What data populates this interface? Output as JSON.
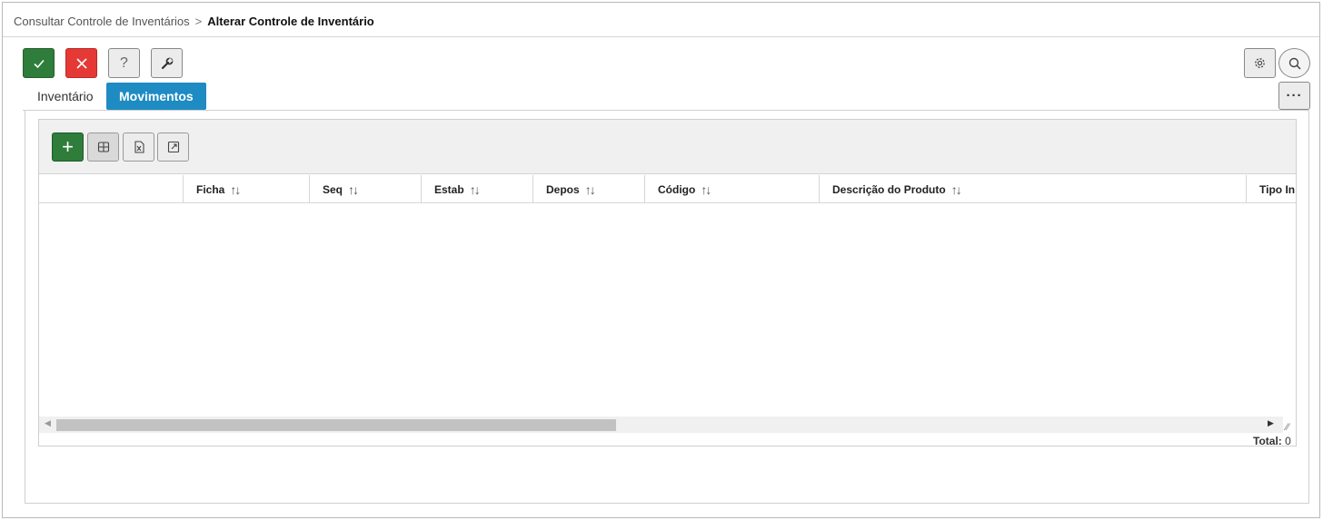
{
  "breadcrumb": {
    "parent": "Consultar Controle de Inventários",
    "separator": ">",
    "current": "Alterar Controle de Inventário"
  },
  "toolbar": {
    "confirm_icon": "check-icon",
    "cancel_icon": "close-icon",
    "help_label": "?",
    "tool_icon": "wrench-icon",
    "settings_icon": "gear-icon",
    "search_icon": "search-icon",
    "more_label": "···"
  },
  "tabs": [
    {
      "label": "Inventário",
      "active": false
    },
    {
      "label": "Movimentos",
      "active": true
    }
  ],
  "grid": {
    "toolbar": {
      "add_label": "+",
      "columns_icon": "grid-icon",
      "excel_icon": "excel-icon",
      "expand_icon": "expand-icon"
    },
    "columns": [
      {
        "label": "",
        "sortable": false
      },
      {
        "label": "Ficha",
        "sortable": true
      },
      {
        "label": "Seq",
        "sortable": true
      },
      {
        "label": "Estab",
        "sortable": true
      },
      {
        "label": "Depos",
        "sortable": true
      },
      {
        "label": "Código",
        "sortable": true
      },
      {
        "label": "Descrição do Produto",
        "sortable": true
      },
      {
        "label": "Tipo In",
        "sortable": false
      }
    ],
    "sort_glyph": "↑↓",
    "rows": [],
    "total_label": "Total:",
    "total_value": "0"
  },
  "colors": {
    "confirm": "#2e7d3a",
    "cancel": "#e53935",
    "active_tab": "#1e8bc3",
    "add": "#2e7d3a"
  }
}
